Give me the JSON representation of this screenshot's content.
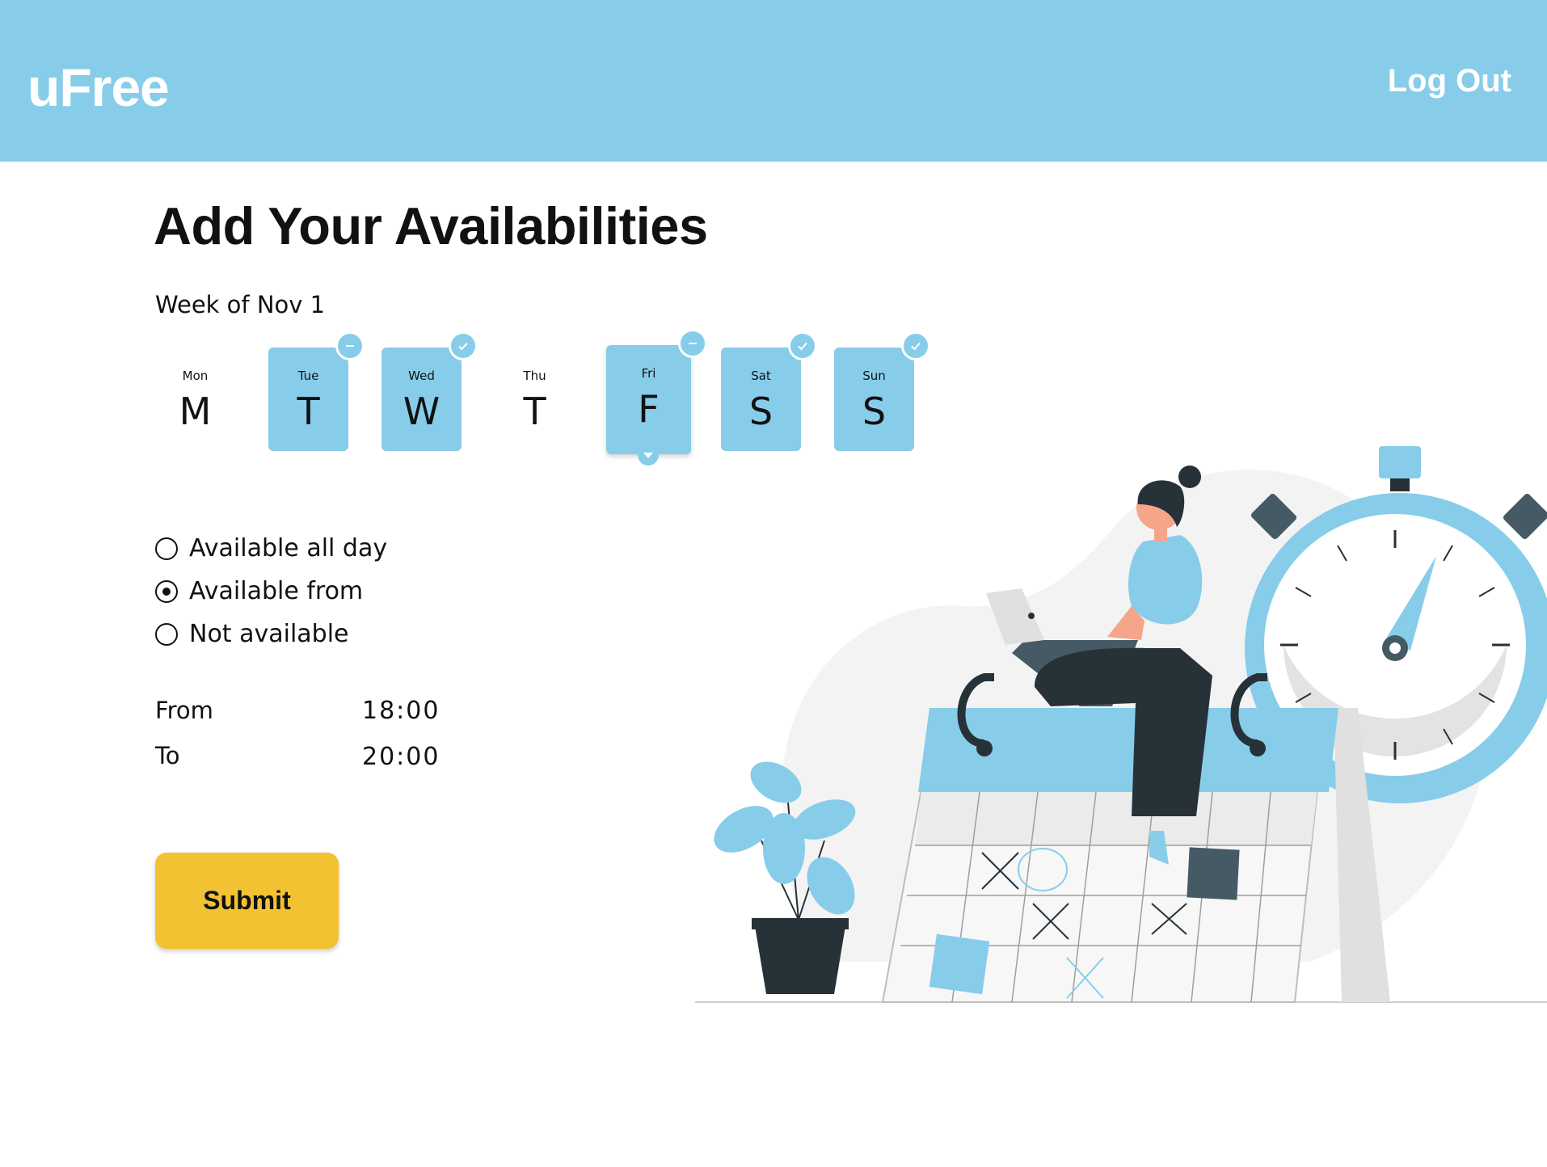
{
  "header": {
    "logo": "uFree",
    "logout_label": "Log Out"
  },
  "main": {
    "title": "Add Your Availabilities",
    "week_label": "Week of Nov 1",
    "days": [
      {
        "short": "Mon",
        "letter": "M",
        "selected": false,
        "badge": "none"
      },
      {
        "short": "Tue",
        "letter": "T",
        "selected": true,
        "badge": "minus"
      },
      {
        "short": "Wed",
        "letter": "W",
        "selected": true,
        "badge": "check"
      },
      {
        "short": "Thu",
        "letter": "T",
        "selected": false,
        "badge": "none"
      },
      {
        "short": "Fri",
        "letter": "F",
        "selected": true,
        "badge": "minus",
        "current": true
      },
      {
        "short": "Sat",
        "letter": "S",
        "selected": true,
        "badge": "check"
      },
      {
        "short": "Sun",
        "letter": "S",
        "selected": true,
        "badge": "check"
      }
    ],
    "options": [
      {
        "label": "Available all day",
        "checked": false
      },
      {
        "label": "Available from",
        "checked": true
      },
      {
        "label": "Not available",
        "checked": false
      }
    ],
    "from_label": "From",
    "from_value": "18:00",
    "to_label": "To",
    "to_value": "20:00",
    "submit_label": "Submit"
  },
  "colors": {
    "accent": "#87CDEA",
    "button": "#F2C232",
    "dark": "#263238"
  },
  "icons": {
    "check": "check-icon",
    "minus": "minus-icon",
    "caret": "caret-down-icon"
  }
}
